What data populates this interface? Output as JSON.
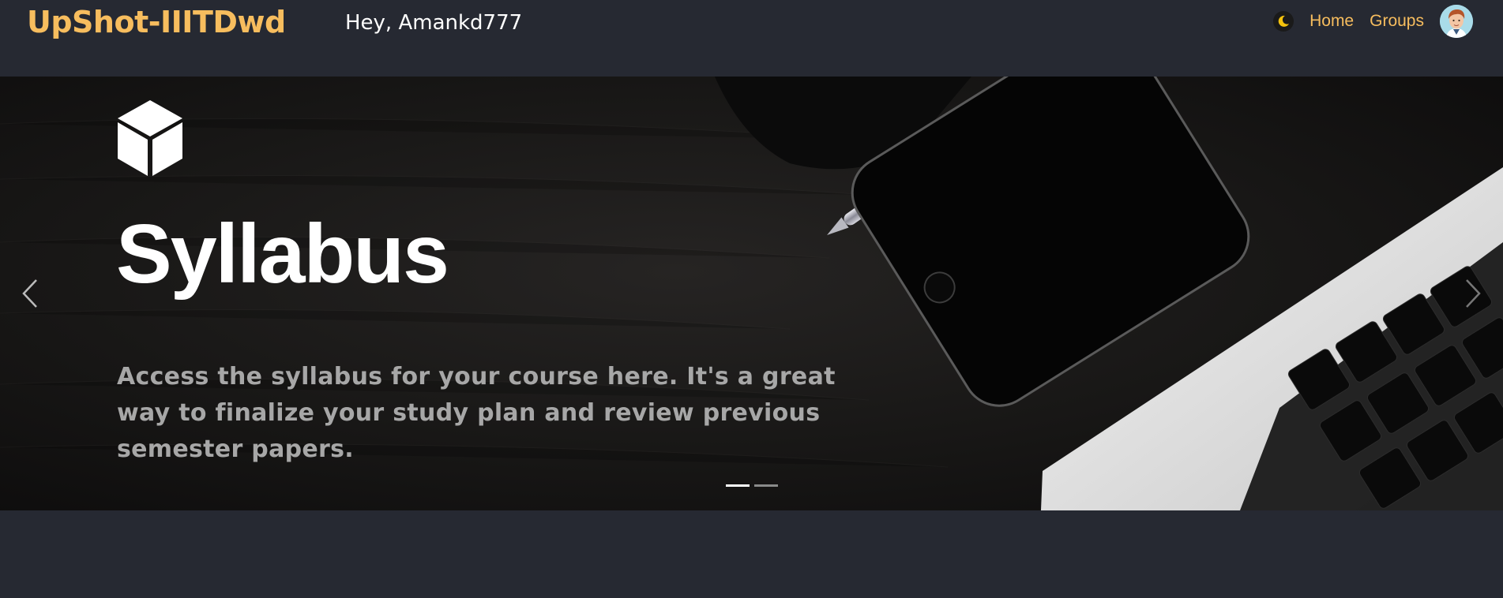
{
  "navbar": {
    "brand": "UpShot-IIITDwd",
    "greeting": "Hey, Amankd777",
    "links": [
      "Home",
      "Groups"
    ],
    "theme_toggle_icon": "moon-icon",
    "avatar_icon": "user-avatar"
  },
  "carousel": {
    "slide": {
      "title": "Syllabus",
      "description": "Access the syllabus for your course here. It's a great way to finalize your study plan and review previous semester papers.",
      "icon": "cube-icon"
    },
    "indicators": [
      {
        "active": true
      },
      {
        "active": false
      }
    ],
    "prev_icon": "chevron-left-icon",
    "next_icon": "chevron-right-icon"
  },
  "colors": {
    "accent": "#f7bd5e",
    "background": "#262932",
    "text": "#ffffff"
  }
}
